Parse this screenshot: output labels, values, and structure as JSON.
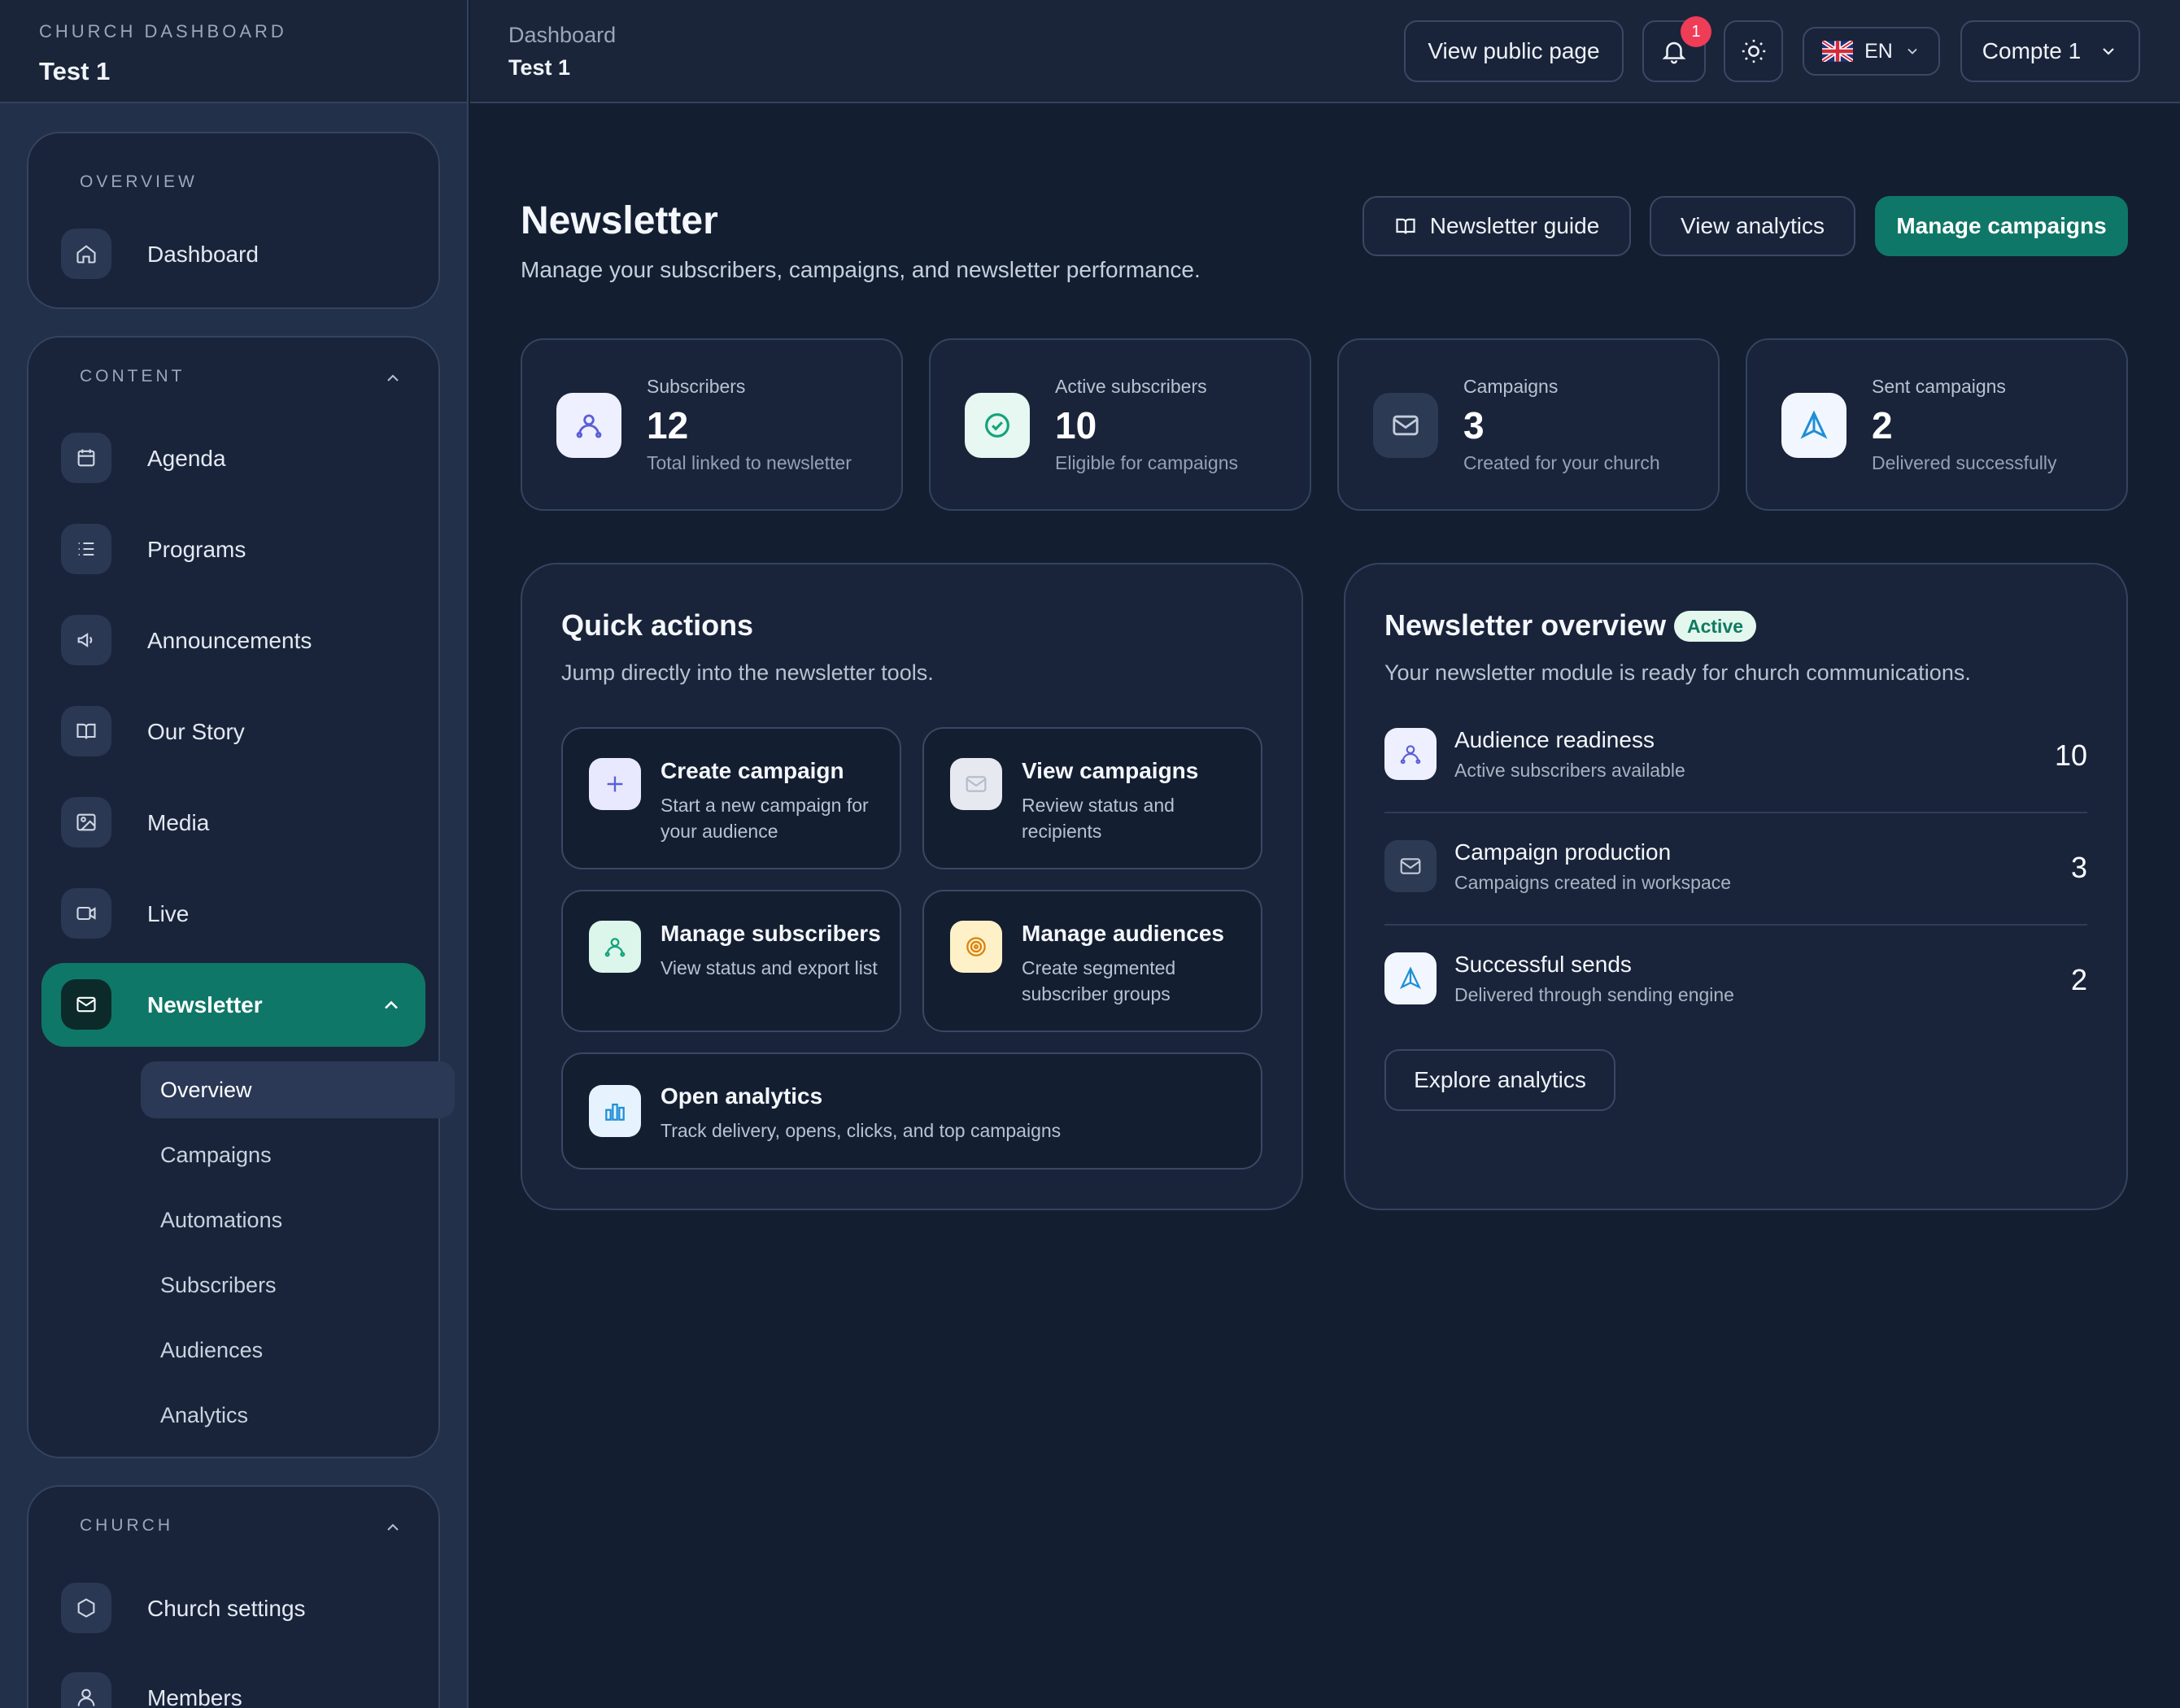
{
  "sidebar": {
    "brand_kicker": "CHURCH DASHBOARD",
    "brand_name": "Test 1",
    "overview_label": "OVERVIEW",
    "dashboard": "Dashboard",
    "content_label": "CONTENT",
    "items": [
      "Agenda",
      "Programs",
      "Announcements",
      "Our Story",
      "Media",
      "Live",
      "Newsletter"
    ],
    "newsletter_sub": [
      "Overview",
      "Campaigns",
      "Automations",
      "Subscribers",
      "Audiences",
      "Analytics"
    ],
    "church_label": "CHURCH",
    "church_items": [
      "Church settings",
      "Members"
    ]
  },
  "header": {
    "crumb": "Dashboard",
    "crumb_current": "Test 1",
    "view_public": "View public page",
    "notifications": "1",
    "language": "EN",
    "account": "Compte 1"
  },
  "page": {
    "title": "Newsletter",
    "subtitle": "Manage your subscribers, campaigns, and newsletter performance.",
    "guide_btn": "Newsletter guide",
    "analytics_btn": "View analytics",
    "manage_btn": "Manage campaigns"
  },
  "stats": [
    {
      "label": "Subscribers",
      "value": "12",
      "note": "Total linked to newsletter"
    },
    {
      "label": "Active subscribers",
      "value": "10",
      "note": "Eligible for campaigns"
    },
    {
      "label": "Campaigns",
      "value": "3",
      "note": "Created for your church"
    },
    {
      "label": "Sent campaigns",
      "value": "2",
      "note": "Delivered successfully"
    }
  ],
  "quick": {
    "title": "Quick actions",
    "subtitle": "Jump directly into the newsletter tools.",
    "actions": [
      {
        "title": "Create campaign",
        "desc": "Start a new campaign for your audience"
      },
      {
        "title": "View campaigns",
        "desc": "Review status and recipients"
      },
      {
        "title": "Manage subscribers",
        "desc": "View status and export list"
      },
      {
        "title": "Manage audiences",
        "desc": "Create segmented subscriber groups"
      },
      {
        "title": "Open analytics",
        "desc": "Track delivery, opens, clicks, and top campaigns"
      }
    ]
  },
  "overview": {
    "title": "Newsletter overview",
    "status": "Active",
    "subtitle": "Your newsletter module is ready for church communications.",
    "rows": [
      {
        "title": "Audience readiness",
        "desc": "Active subscribers available",
        "value": "10"
      },
      {
        "title": "Campaign production",
        "desc": "Campaigns created in workspace",
        "value": "3"
      },
      {
        "title": "Successful sends",
        "desc": "Delivered through sending engine",
        "value": "2"
      }
    ],
    "explore_btn": "Explore analytics"
  }
}
